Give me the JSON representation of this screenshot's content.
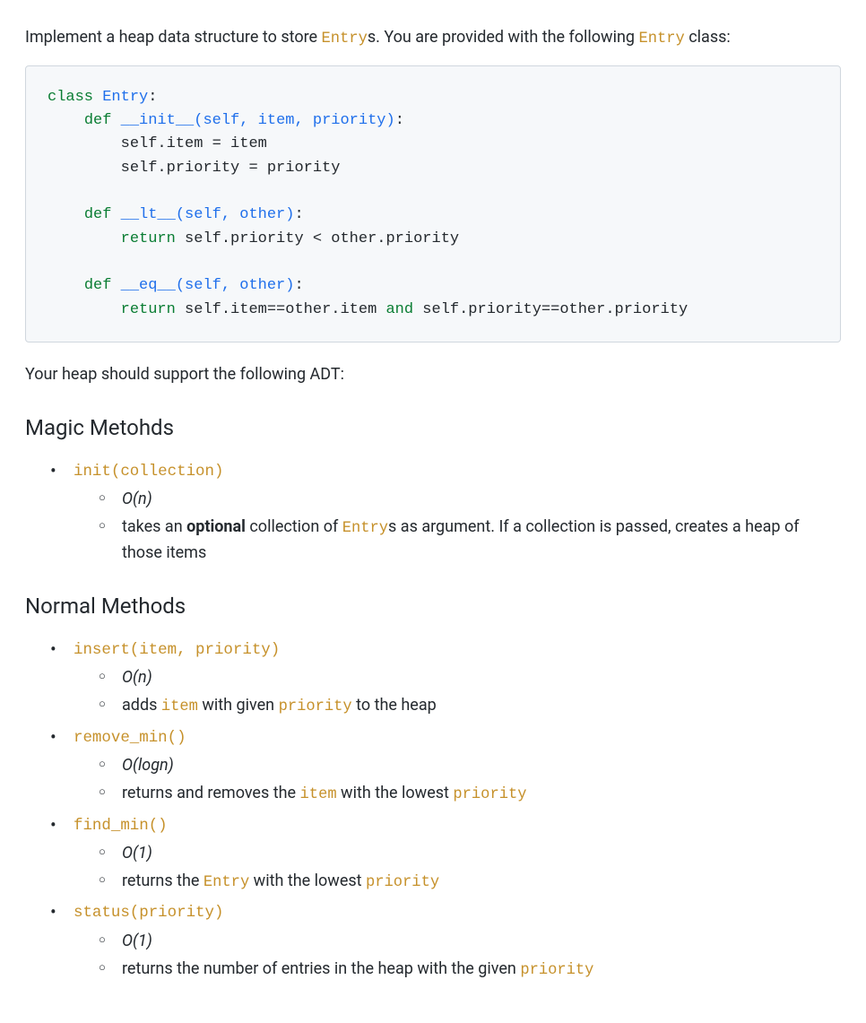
{
  "intro": {
    "pre": "Implement a heap data structure to store ",
    "entry": "Entry",
    "mid": "s. You are provided with the following ",
    "entry2": "Entry",
    "post": " class:"
  },
  "code": {
    "kw_class": "class",
    "cls_name": "Entry",
    "colon": ":",
    "kw_def1": "def",
    "fn_init": "__init__",
    "params_init_open": "(self, item, priority)",
    "body_init1": "self.item = item",
    "body_init2": "self.priority = priority",
    "kw_def2": "def",
    "fn_lt": "__lt__",
    "params_lt": "(self, other)",
    "kw_return1": "return",
    "body_lt": " self.priority < other.priority",
    "kw_def3": "def",
    "fn_eq": "__eq__",
    "params_eq": "(self, other)",
    "kw_return2": "return",
    "body_eq_a": " self.item==other.item ",
    "kw_and": "and",
    "body_eq_b": " self.priority==other.priority"
  },
  "adt_intro": "Your heap should support the following ADT:",
  "section_magic": "Magic Metohds",
  "section_normal": "Normal Methods",
  "magic": {
    "init": {
      "sig": "init(collection)",
      "big_o": "O(n)",
      "desc_pre": "takes an ",
      "desc_bold": "optional",
      "desc_mid": " collection of ",
      "desc_entry": "Entry",
      "desc_post": "s as argument. If a collection is passed, creates a heap of those items"
    }
  },
  "normal": {
    "insert": {
      "sig": "insert(item, priority)",
      "big_o": "O(n)",
      "desc_pre": "adds ",
      "desc_item": "item",
      "desc_mid": " with given ",
      "desc_priority": "priority",
      "desc_post": " to the heap"
    },
    "remove_min": {
      "sig": "remove_min()",
      "big_o": "O(logn)",
      "desc_pre": "returns and removes the ",
      "desc_item": "item",
      "desc_mid": " with the lowest ",
      "desc_priority": "priority"
    },
    "find_min": {
      "sig": "find_min()",
      "big_o": "O(1)",
      "desc_pre": "returns the ",
      "desc_entry": "Entry",
      "desc_mid": " with the lowest ",
      "desc_priority": "priority"
    },
    "status": {
      "sig": "status(priority)",
      "big_o": "O(1)",
      "desc_pre": "returns the number of entries in the heap with the given ",
      "desc_priority": "priority"
    }
  }
}
